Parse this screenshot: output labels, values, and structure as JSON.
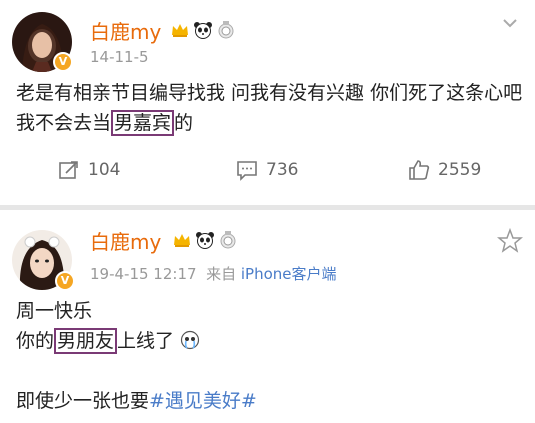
{
  "posts": [
    {
      "username": "白鹿my",
      "timestamp": "14-11-5",
      "content_part1": "老是有相亲节目编导找我 问我有没有兴趣 你们死了这条心吧 我不会去当",
      "content_boxed": "男嘉宾",
      "content_part2": "的",
      "repost_count": "104",
      "comment_count": "736",
      "like_count": "2559"
    },
    {
      "username": "白鹿my",
      "timestamp": "19-4-15 12:17",
      "source_prefix": "来自",
      "source_device": "iPhone客户端",
      "line1": "周一快乐",
      "line2_prefix": "你的",
      "line2_boxed": "男朋友",
      "line2_suffix": "上线了",
      "line3_prefix": "即使少一张也要",
      "line3_hashtag": "#遇见美好#"
    }
  ],
  "colors": {
    "username": "#e86b0c",
    "link": "#4a7cc8",
    "highlight_box": "#7a3a75",
    "verified_badge": "#f5a623"
  },
  "icons": [
    "verified-v-icon",
    "crown-badge-icon",
    "panda-badge-icon",
    "medal-badge-icon",
    "repost-icon",
    "comment-icon",
    "like-icon",
    "star-icon",
    "chevron-down-icon",
    "crying-emoji-icon"
  ]
}
